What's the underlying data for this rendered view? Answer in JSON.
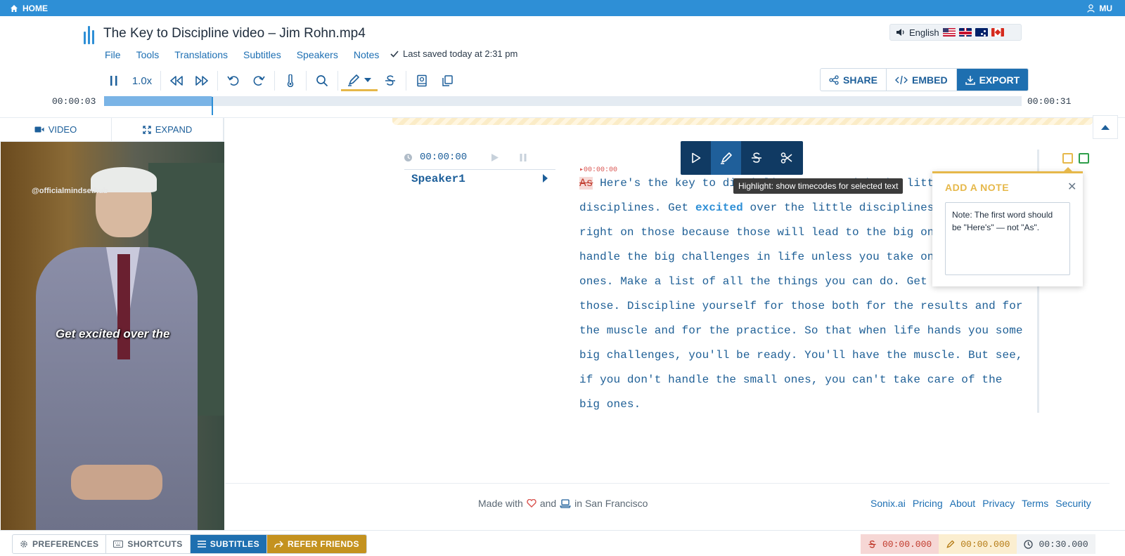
{
  "topbar": {
    "home": "HOME",
    "user": "MU"
  },
  "header": {
    "title": "The Key to Discipline video – Jim Rohn.mp4",
    "menu": [
      "File",
      "Tools",
      "Translations",
      "Subtitles",
      "Speakers",
      "Notes"
    ],
    "saved": "Last saved today at 2:31 pm",
    "language": "English",
    "flags": [
      "us-flag",
      "uk-flag",
      "australia-flag",
      "canada-flag"
    ]
  },
  "toolbar": {
    "speed": "1.0x"
  },
  "actions": {
    "share": "SHARE",
    "embed": "EMBED",
    "export": "EXPORT"
  },
  "timeline": {
    "current": "00:00:03",
    "total": "00:00:31",
    "progress": 0.117
  },
  "left_panel": {
    "tabs": {
      "video": "VIDEO",
      "expand": "EXPAND"
    },
    "video_watermark": "@officialmindsethub",
    "video_caption": "Get excited over the"
  },
  "transcript": {
    "time": "00:00:00",
    "speaker": "Speaker1",
    "timecode_mark": "▸00:00:00",
    "struck_word": "As",
    "lines": [
      " Here's the key to discipline. Start with the little",
      "disciplines. Get ",
      " over the little disciplines. Get",
      "right on those because those will lead to the big ones.",
      "handle the big challenges in life unless you take on",
      "ones. Make a list of all the things you can do. Get",
      "those. Discipline yourself for those both for the results and for",
      "the muscle and for the practice. So that when life hands you some",
      "big challenges, you'll be ready. You'll have the muscle. But see,",
      "if you don't handle the small ones, you can't take care of the",
      "big ones."
    ],
    "bold_word": "excited"
  },
  "tooltip": "Highlight: show timecodes for selected text",
  "note": {
    "heading": "ADD A NOTE",
    "text": "Note: The first word should be \"Here's\" — not \"As\"."
  },
  "footer": {
    "made_with": "Made with",
    "and": "and",
    "in": "in San Francisco",
    "links": [
      "Sonix.ai",
      "Pricing",
      "About",
      "Privacy",
      "Terms",
      "Security"
    ]
  },
  "bottombar": {
    "preferences": "PREFERENCES",
    "shortcuts": "SHORTCUTS",
    "subtitles": "SUBTITLES",
    "refer": "REFER FRIENDS",
    "strike_time": "00:00.000",
    "highlight_time": "00:00.000",
    "duration": "00:30.000"
  },
  "colors": {
    "accent": "#2e8fd6",
    "export": "#1e6fb0",
    "highlight": "#e6b84a",
    "strike": "#c0392b",
    "refer": "#c4921f"
  }
}
